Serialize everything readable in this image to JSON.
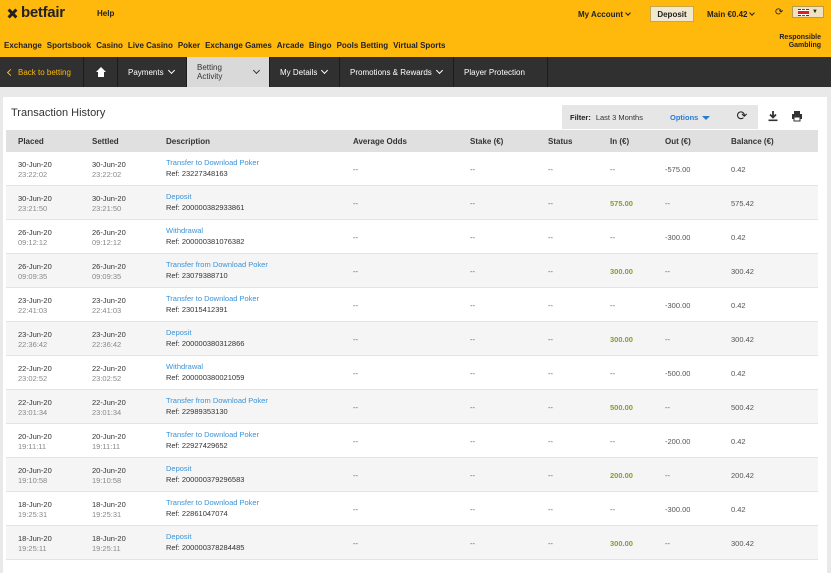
{
  "header": {
    "logo_text": "betfair",
    "help": "Help",
    "my_account": "My Account",
    "deposit": "Deposit",
    "main_balance": "Main €0.42",
    "language_flag": "uk-flag-icon",
    "nav": [
      "Exchange",
      "Sportsbook",
      "Casino",
      "Live Casino",
      "Poker",
      "Exchange Games",
      "Arcade",
      "Bingo",
      "Pools Betting",
      "Virtual Sports"
    ],
    "responsible_gambling": [
      "Responsible",
      "Gambling"
    ],
    "brand_color": "#ffb80c"
  },
  "subnav": {
    "back": "Back to betting",
    "home_icon": "home-icon",
    "payments": "Payments",
    "betting_activity": "Betting Activity",
    "my_details": "My Details",
    "promotions": "Promotions & Rewards",
    "player_protection": "Player Protection"
  },
  "page": {
    "title": "Transaction History",
    "filter_label": "Filter:",
    "filter_value": "Last 3 Months",
    "options": "Options"
  },
  "table": {
    "columns": [
      "Placed",
      "Settled",
      "Description",
      "Average Odds",
      "Stake (€)",
      "Status",
      "In (€)",
      "Out (€)",
      "Balance (€)"
    ],
    "rows": [
      {
        "placed_date": "30-Jun-20",
        "placed_time": "23:22:02",
        "settled_date": "30-Jun-20",
        "settled_time": "23:22:02",
        "desc": "Transfer to Download Poker",
        "ref": "Ref: 23227348163",
        "odds": "--",
        "stake": "--",
        "status": "--",
        "in": "--",
        "out": "-575.00",
        "balance": "0.42"
      },
      {
        "placed_date": "30-Jun-20",
        "placed_time": "23:21:50",
        "settled_date": "30-Jun-20",
        "settled_time": "23:21:50",
        "desc": "Deposit",
        "ref": "Ref: 200000382933861",
        "odds": "--",
        "stake": "--",
        "status": "--",
        "in": "575.00",
        "out": "--",
        "balance": "575.42"
      },
      {
        "placed_date": "26-Jun-20",
        "placed_time": "09:12:12",
        "settled_date": "26-Jun-20",
        "settled_time": "09:12:12",
        "desc": "Withdrawal",
        "ref": "Ref: 200000381076382",
        "odds": "--",
        "stake": "--",
        "status": "--",
        "in": "--",
        "out": "-300.00",
        "balance": "0.42"
      },
      {
        "placed_date": "26-Jun-20",
        "placed_time": "09:09:35",
        "settled_date": "26-Jun-20",
        "settled_time": "09:09:35",
        "desc": "Transfer from Download Poker",
        "ref": "Ref: 23079388710",
        "odds": "--",
        "stake": "--",
        "status": "--",
        "in": "300.00",
        "out": "--",
        "balance": "300.42"
      },
      {
        "placed_date": "23-Jun-20",
        "placed_time": "22:41:03",
        "settled_date": "23-Jun-20",
        "settled_time": "22:41:03",
        "desc": "Transfer to Download Poker",
        "ref": "Ref: 23015412391",
        "odds": "--",
        "stake": "--",
        "status": "--",
        "in": "--",
        "out": "-300.00",
        "balance": "0.42"
      },
      {
        "placed_date": "23-Jun-20",
        "placed_time": "22:36:42",
        "settled_date": "23-Jun-20",
        "settled_time": "22:36:42",
        "desc": "Deposit",
        "ref": "Ref: 200000380312866",
        "odds": "--",
        "stake": "--",
        "status": "--",
        "in": "300.00",
        "out": "--",
        "balance": "300.42"
      },
      {
        "placed_date": "22-Jun-20",
        "placed_time": "23:02:52",
        "settled_date": "22-Jun-20",
        "settled_time": "23:02:52",
        "desc": "Withdrawal",
        "ref": "Ref: 200000380021059",
        "odds": "--",
        "stake": "--",
        "status": "--",
        "in": "--",
        "out": "-500.00",
        "balance": "0.42"
      },
      {
        "placed_date": "22-Jun-20",
        "placed_time": "23:01:34",
        "settled_date": "22-Jun-20",
        "settled_time": "23:01:34",
        "desc": "Transfer from Download Poker",
        "ref": "Ref: 22989353130",
        "odds": "--",
        "stake": "--",
        "status": "--",
        "in": "500.00",
        "out": "--",
        "balance": "500.42"
      },
      {
        "placed_date": "20-Jun-20",
        "placed_time": "19:11:11",
        "settled_date": "20-Jun-20",
        "settled_time": "19:11:11",
        "desc": "Transfer to Download Poker",
        "ref": "Ref: 22927429652",
        "odds": "--",
        "stake": "--",
        "status": "--",
        "in": "--",
        "out": "-200.00",
        "balance": "0.42"
      },
      {
        "placed_date": "20-Jun-20",
        "placed_time": "19:10:58",
        "settled_date": "20-Jun-20",
        "settled_time": "19:10:58",
        "desc": "Deposit",
        "ref": "Ref: 200000379296583",
        "odds": "--",
        "stake": "--",
        "status": "--",
        "in": "200.00",
        "out": "--",
        "balance": "200.42"
      },
      {
        "placed_date": "18-Jun-20",
        "placed_time": "19:25:31",
        "settled_date": "18-Jun-20",
        "settled_time": "19:25:31",
        "desc": "Transfer to Download Poker",
        "ref": "Ref: 22861047074",
        "odds": "--",
        "stake": "--",
        "status": "--",
        "in": "--",
        "out": "-300.00",
        "balance": "0.42"
      },
      {
        "placed_date": "18-Jun-20",
        "placed_time": "19:25:11",
        "settled_date": "18-Jun-20",
        "settled_time": "19:25:11",
        "desc": "Deposit",
        "ref": "Ref: 200000378284485",
        "odds": "--",
        "stake": "--",
        "status": "--",
        "in": "300.00",
        "out": "--",
        "balance": "300.42"
      }
    ]
  }
}
